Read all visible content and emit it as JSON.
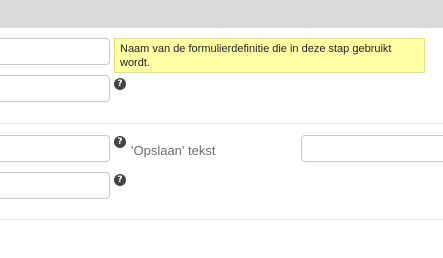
{
  "tooltip": {
    "text": "Naam van de formulierdefinitie die in deze stap gebruikt wordt."
  },
  "fields": {
    "form_definition": {
      "value": ""
    },
    "field_2": {
      "value": ""
    },
    "field_3": {
      "value": ""
    },
    "save_text": {
      "label": "'Opslaan' tekst",
      "value": ""
    },
    "field_5": {
      "value": ""
    }
  },
  "icons": {
    "help": "?"
  },
  "colors": {
    "tooltip_bg": "#ffffa6",
    "help_icon": "#444444"
  }
}
